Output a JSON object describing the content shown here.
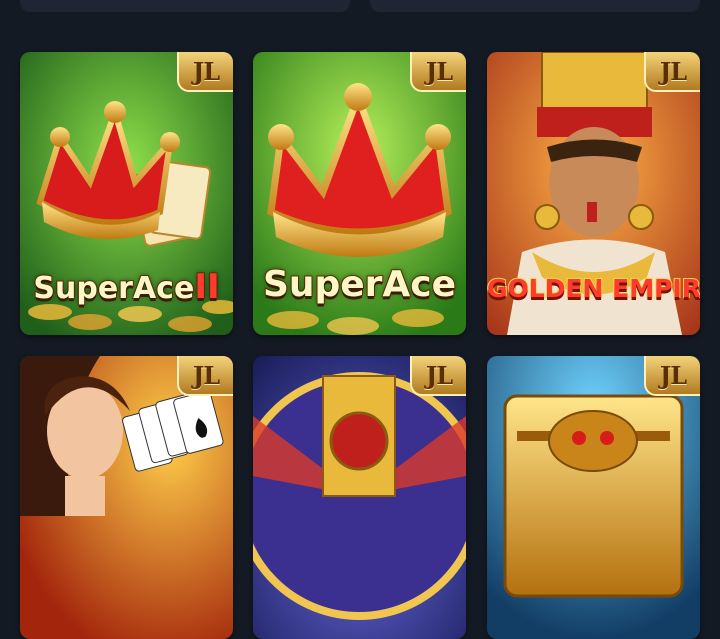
{
  "provider_badge": "JL",
  "games": [
    {
      "title": "SuperAce",
      "suffix": "II"
    },
    {
      "title": "SuperAce",
      "suffix": ""
    },
    {
      "title": "GOLDEN EMPIRE",
      "suffix": ""
    },
    {
      "title": "",
      "suffix": ""
    },
    {
      "title": "",
      "suffix": ""
    },
    {
      "title": "",
      "suffix": ""
    }
  ],
  "colors": {
    "background": "#141a24",
    "badge_gold": "#d9a441",
    "title_gold": "#fff6c8"
  }
}
